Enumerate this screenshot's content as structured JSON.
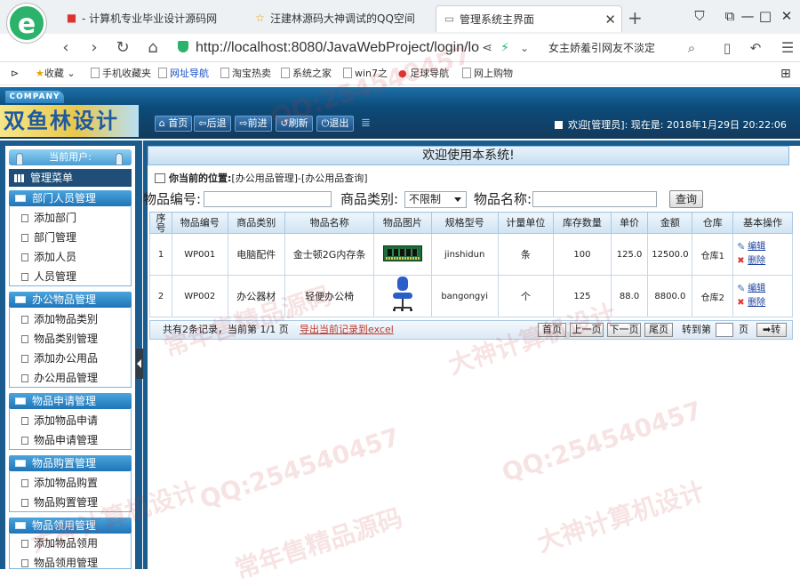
{
  "browser": {
    "tabs": [
      {
        "title": "- 计算机专业毕业设计源码网",
        "icon": "red-flag-icon"
      },
      {
        "title": "汪建林源码大神调试的QQ空间",
        "icon": "star-icon"
      },
      {
        "title": "管理系统主界面",
        "icon": "page-icon",
        "active": true
      }
    ],
    "new_tab": "+",
    "address": "http://localhost:8080/JavaWebProject/login/lo",
    "promo_text": "女主娇羞引网友不淡定",
    "bookmarks": [
      "收藏",
      "手机收藏夹",
      "网址导航",
      "淘宝热卖",
      "系统之家",
      "win7之",
      "足球导航",
      "网上购物"
    ]
  },
  "app": {
    "company_label": "COMPANY",
    "brand": "双鱼林设计",
    "toolbar": [
      "首页",
      "后退",
      "前进",
      "刷新",
      "退出"
    ],
    "welcome_user": "欢迎[管理员]:   现在是: 2018年1月29日 20:22:06"
  },
  "sidebar": {
    "current_user_label": "当前用户:",
    "root_menu": "管理菜单",
    "groups": [
      {
        "title": "部门人员管理",
        "items": [
          "添加部门",
          "部门管理",
          "添加人员",
          "人员管理"
        ]
      },
      {
        "title": "办公物品管理",
        "items": [
          "添加物品类别",
          "物品类别管理",
          "添加办公用品",
          "办公用品管理"
        ]
      },
      {
        "title": "物品申请管理",
        "items": [
          "添加物品申请",
          "物品申请管理"
        ]
      },
      {
        "title": "物品购置管理",
        "items": [
          "添加物品购置",
          "物品购置管理"
        ]
      },
      {
        "title": "物品领用管理",
        "items": [
          "添加物品领用",
          "物品领用管理"
        ]
      }
    ]
  },
  "main": {
    "welcome_banner": "欢迎使用本系统!",
    "location_label": "你当前的位置:",
    "location_path": "[办公用品管理]-[办公用品查询]",
    "search": {
      "code_label": "物品编号:",
      "category_label": "商品类别:",
      "category_value": "不限制",
      "name_label": "物品名称:",
      "query_button": "查询"
    },
    "table": {
      "headers": [
        "序号",
        "物品编号",
        "商品类别",
        "物品名称",
        "物品图片",
        "规格型号",
        "计量单位",
        "库存数量",
        "单价",
        "金额",
        "仓库",
        "基本操作"
      ],
      "rows": [
        {
          "seq": "1",
          "code": "WP001",
          "category": "电脑配件",
          "name": "金士顿2G内存条",
          "image": "ram-stick-icon",
          "spec": "jinshidun",
          "unit": "条",
          "stock": "100",
          "price": "125.0",
          "amount": "12500.0",
          "warehouse": "仓库1"
        },
        {
          "seq": "2",
          "code": "WP002",
          "category": "办公器材",
          "name": "轻便办公椅",
          "image": "office-chair-icon",
          "spec": "bangongyi",
          "unit": "个",
          "stock": "125",
          "price": "88.0",
          "amount": "8800.0",
          "warehouse": "仓库2"
        }
      ],
      "op_edit": "编辑",
      "op_delete": "删除"
    },
    "pager": {
      "info": "共有2条记录，当前第 1/1 页",
      "export": "导出当前记录到excel",
      "first": "首页",
      "prev": "上一页",
      "next": "下一页",
      "last": "尾页",
      "goto_label": "转到第",
      "page_unit": "页",
      "go_button": "转"
    }
  },
  "watermarks": [
    "QQ:254540457",
    "常年售精品源码",
    "大神计算机设计",
    "QQ:254540457",
    "大神计算机设计",
    "常年售精品源码",
    "QQ:254540457",
    "大神计算机设计"
  ]
}
